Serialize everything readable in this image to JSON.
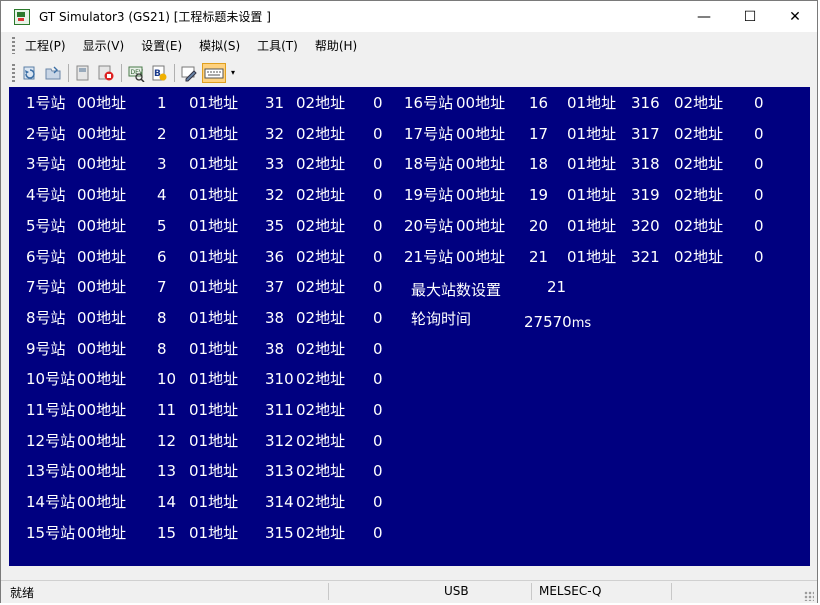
{
  "window": {
    "title": "GT Simulator3 (GS21)  [工程标题未设置 ]",
    "controls": {
      "minimize": "—",
      "maximize": "☐",
      "close": "✕"
    }
  },
  "menu": {
    "items": [
      "工程(P)",
      "显示(V)",
      "设置(E)",
      "模拟(S)",
      "工具(T)",
      "帮助(H)"
    ]
  },
  "toolbar": {
    "buttons": [
      "refresh-icon",
      "open-icon",
      "stop-icon",
      "record-icon",
      "device-monitor-icon",
      "script-icon",
      "edit-icon",
      "keyboard-icon"
    ]
  },
  "screen": {
    "background": "#000080",
    "left_rows": [
      {
        "station": "1号站",
        "a0": "00地址",
        "v0": "1",
        "a1": "01地址",
        "v1": "31",
        "a2": "02地址",
        "v2": "0"
      },
      {
        "station": "2号站",
        "a0": "00地址",
        "v0": "2",
        "a1": "01地址",
        "v1": "32",
        "a2": "02地址",
        "v2": "0"
      },
      {
        "station": "3号站",
        "a0": "00地址",
        "v0": "3",
        "a1": "01地址",
        "v1": "33",
        "a2": "02地址",
        "v2": "0"
      },
      {
        "station": "4号站",
        "a0": "00地址",
        "v0": "4",
        "a1": "01地址",
        "v1": "32",
        "a2": "02地址",
        "v2": "0"
      },
      {
        "station": "5号站",
        "a0": "00地址",
        "v0": "5",
        "a1": "01地址",
        "v1": "35",
        "a2": "02地址",
        "v2": "0"
      },
      {
        "station": "6号站",
        "a0": "00地址",
        "v0": "6",
        "a1": "01地址",
        "v1": "36",
        "a2": "02地址",
        "v2": "0"
      },
      {
        "station": "7号站",
        "a0": "00地址",
        "v0": "7",
        "a1": "01地址",
        "v1": "37",
        "a2": "02地址",
        "v2": "0"
      },
      {
        "station": "8号站",
        "a0": "00地址",
        "v0": "8",
        "a1": "01地址",
        "v1": "38",
        "a2": "02地址",
        "v2": "0"
      },
      {
        "station": "9号站",
        "a0": "00地址",
        "v0": "8",
        "a1": "01地址",
        "v1": "38",
        "a2": "02地址",
        "v2": "0"
      },
      {
        "station": "10号站",
        "a0": "00地址",
        "v0": "10",
        "a1": "01地址",
        "v1": "310",
        "a2": "02地址",
        "v2": "0"
      },
      {
        "station": "11号站",
        "a0": "00地址",
        "v0": "11",
        "a1": "01地址",
        "v1": "311",
        "a2": "02地址",
        "v2": "0"
      },
      {
        "station": "12号站",
        "a0": "00地址",
        "v0": "12",
        "a1": "01地址",
        "v1": "312",
        "a2": "02地址",
        "v2": "0"
      },
      {
        "station": "13号站",
        "a0": "00地址",
        "v0": "13",
        "a1": "01地址",
        "v1": "313",
        "a2": "02地址",
        "v2": "0"
      },
      {
        "station": "14号站",
        "a0": "00地址",
        "v0": "14",
        "a1": "01地址",
        "v1": "314",
        "a2": "02地址",
        "v2": "0"
      },
      {
        "station": "15号站",
        "a0": "00地址",
        "v0": "15",
        "a1": "01地址",
        "v1": "315",
        "a2": "02地址",
        "v2": "0"
      }
    ],
    "right_rows": [
      {
        "station": "16号站",
        "a0": "00地址",
        "v0": "16",
        "a1": "01地址",
        "v1": "316",
        "a2": "02地址",
        "v2": "0"
      },
      {
        "station": "17号站",
        "a0": "00地址",
        "v0": "17",
        "a1": "01地址",
        "v1": "317",
        "a2": "02地址",
        "v2": "0"
      },
      {
        "station": "18号站",
        "a0": "00地址",
        "v0": "18",
        "a1": "01地址",
        "v1": "318",
        "a2": "02地址",
        "v2": "0"
      },
      {
        "station": "19号站",
        "a0": "00地址",
        "v0": "19",
        "a1": "01地址",
        "v1": "319",
        "a2": "02地址",
        "v2": "0"
      },
      {
        "station": "20号站",
        "a0": "00地址",
        "v0": "20",
        "a1": "01地址",
        "v1": "320",
        "a2": "02地址",
        "v2": "0"
      },
      {
        "station": "21号站",
        "a0": "00地址",
        "v0": "21",
        "a1": "01地址",
        "v1": "321",
        "a2": "02地址",
        "v2": "0"
      }
    ],
    "max_stations_label": "最大站数设置",
    "max_stations_value": "21",
    "poll_time_label": "轮询时间",
    "poll_time_value": "27570",
    "poll_time_unit": "ms"
  },
  "statusbar": {
    "status": "就绪",
    "connection": "USB",
    "plc_type": "MELSEC-Q"
  }
}
